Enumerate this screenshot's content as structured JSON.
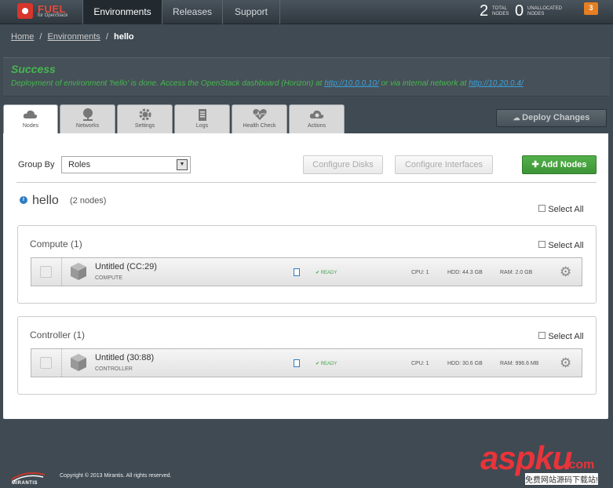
{
  "app": {
    "logo_text": "FUEL",
    "logo_sub": "for OpenStack"
  },
  "nav": {
    "tabs": [
      "Environments",
      "Releases",
      "Support"
    ],
    "active": "Environments"
  },
  "stats": {
    "total_nodes": "2",
    "total_label_1": "TOTAL",
    "total_label_2": "NODES",
    "unallocated": "0",
    "unalloc_label_1": "UNALLOCATED",
    "unalloc_label_2": "NODES",
    "notifications": "3"
  },
  "breadcrumb": {
    "home": "Home",
    "environments": "Environments",
    "current": "hello",
    "sep": "/"
  },
  "banner": {
    "title": "Success",
    "msg_before": "Deployment of environment 'hello' is done. Access the OpenStack dashboard (Horizon) at ",
    "link1": "http://10.0.0.10/",
    "msg_mid": " or via internal network at ",
    "link2": "http://10.20.0.4/"
  },
  "tabs": [
    {
      "label": "Nodes",
      "icon": "cloud-icon"
    },
    {
      "label": "Networks",
      "icon": "network-icon"
    },
    {
      "label": "Settings",
      "icon": "gear-icon"
    },
    {
      "label": "Logs",
      "icon": "clipboard-icon"
    },
    {
      "label": "Health Check",
      "icon": "heartbeat-icon"
    },
    {
      "label": "Actions",
      "icon": "cloud-gear-icon"
    }
  ],
  "deploy_label": "Deploy Changes",
  "toolbar": {
    "group_by_label": "Group By",
    "group_by_value": "Roles",
    "configure_disks": "Configure Disks",
    "configure_interfaces": "Configure Interfaces",
    "add_nodes": "Add Nodes"
  },
  "environment": {
    "name": "hello",
    "count": "(2 nodes)",
    "select_all": "Select All"
  },
  "groups": [
    {
      "title": "Compute (1)",
      "select_all": "Select All",
      "node": {
        "name": "Untitled (CC:29)",
        "role": "COMPUTE",
        "status": "READY",
        "cpu": "CPU: 1",
        "hdd": "HDD: 44.3 GB",
        "ram": "RAM: 2.0 GB"
      }
    },
    {
      "title": "Controller (1)",
      "select_all": "Select All",
      "node": {
        "name": "Untitled (30:88)",
        "role": "CONTROLLER",
        "status": "READY",
        "cpu": "CPU: 1",
        "hdd": "HDD: 30.6 GB",
        "ram": "RAM: 996.6 MB"
      }
    }
  ],
  "footer": {
    "brand": "MIRANTIS",
    "copyright": "Copyright © 2013 Mirantis. All rights reserved."
  },
  "watermark": {
    "asp": "aspku",
    "com": ".com",
    "sub": "免费网站源码下载站!"
  },
  "colors": {
    "success": "#45b84f",
    "link": "#3ba2de",
    "add_button": "#4aa342",
    "accent": "#d6362c"
  }
}
